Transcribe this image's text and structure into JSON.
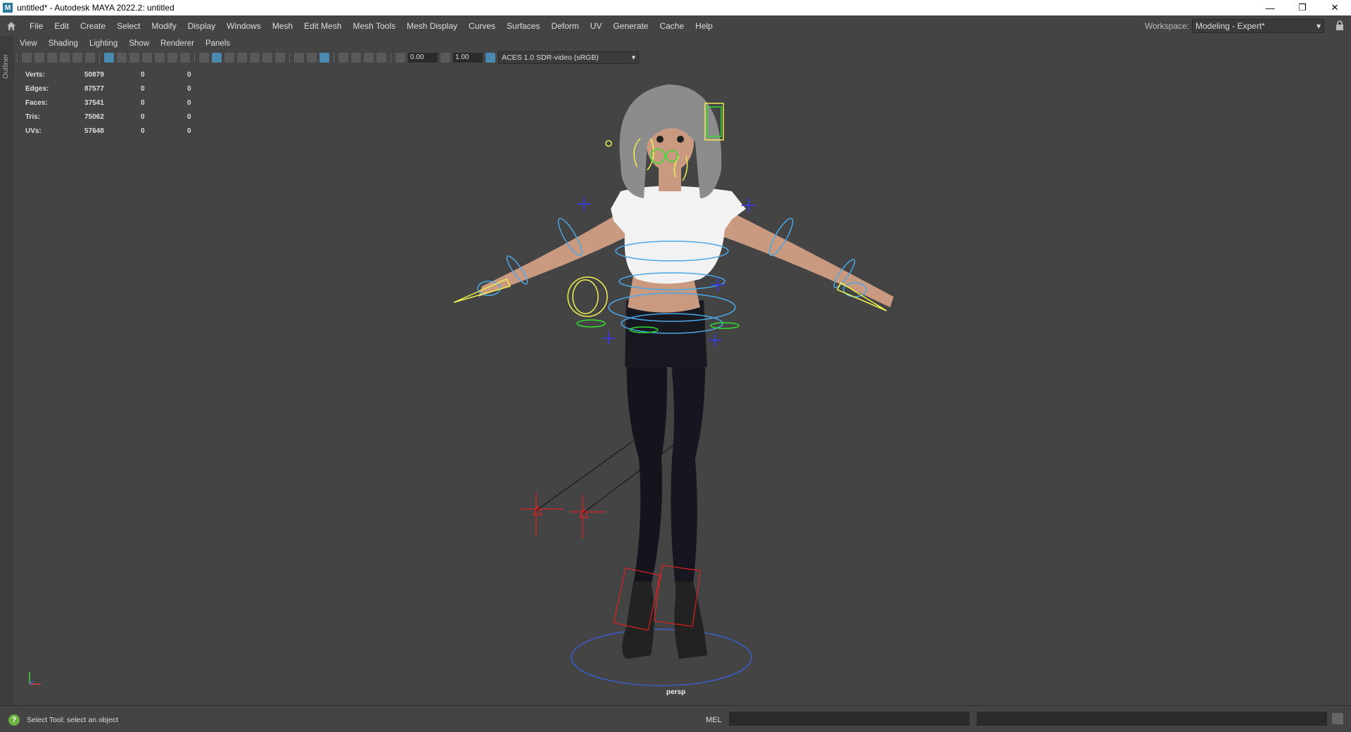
{
  "window": {
    "title": "untitled* - Autodesk MAYA 2022.2: untitled",
    "app_icon_letter": "M",
    "controls": [
      "—",
      "❐",
      "✕"
    ]
  },
  "menubar": {
    "items": [
      "File",
      "Edit",
      "Create",
      "Select",
      "Modify",
      "Display",
      "Windows",
      "Mesh",
      "Edit Mesh",
      "Mesh Tools",
      "Mesh Display",
      "Curves",
      "Surfaces",
      "Deform",
      "UV",
      "Generate",
      "Cache",
      "Help"
    ],
    "workspace_label": "Workspace:",
    "workspace_value": "Modeling - Expert*"
  },
  "outliner": {
    "label": "Outliner"
  },
  "panel_menu": [
    "View",
    "Shading",
    "Lighting",
    "Show",
    "Renderer",
    "Panels"
  ],
  "panel_toolbar": {
    "exposure": "0.00",
    "gamma": "1.00",
    "color_space": "ACES 1.0 SDR-video (sRGB)"
  },
  "hud": {
    "rows": [
      {
        "label": "Verts:",
        "a": "50879",
        "b": "0",
        "c": "0"
      },
      {
        "label": "Edges:",
        "a": "87577",
        "b": "0",
        "c": "0"
      },
      {
        "label": "Faces:",
        "a": "37541",
        "b": "0",
        "c": "0"
      },
      {
        "label": "Tris:",
        "a": "75062",
        "b": "0",
        "c": "0"
      },
      {
        "label": "UVs:",
        "a": "57648",
        "b": "0",
        "c": "0"
      }
    ]
  },
  "viewport": {
    "camera": "persp"
  },
  "statusbar": {
    "message": "Select Tool: select an object",
    "mel_label": "MEL"
  },
  "colors": {
    "rig_blue": "#4aa8e8",
    "rig_yellow": "#f0f050",
    "rig_green": "#30e030",
    "rig_red": "#e02020",
    "shirt": "#f2f2f2",
    "pants": "#151520",
    "skin": "#c99a80"
  }
}
